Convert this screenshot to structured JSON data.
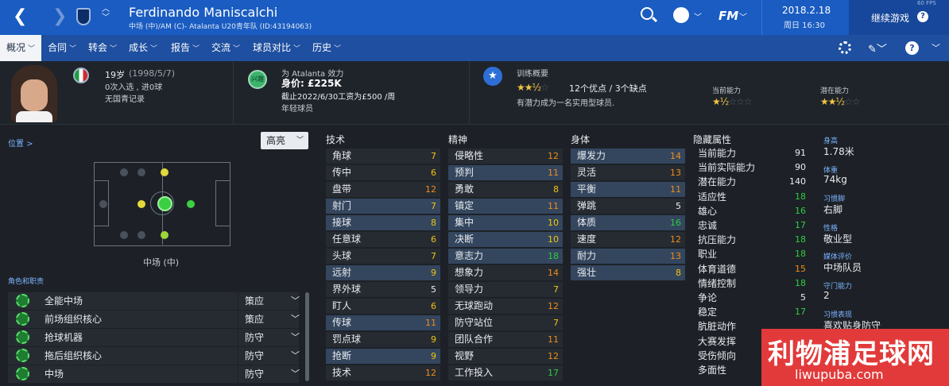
{
  "header": {
    "name": "Ferdinando Maniscalchi",
    "subtitle": "中场 (中)/AM (C)- Atalanta U20青年队 (ID:43194063)",
    "date": "2018.2.18",
    "weekday_time": "周日 16:30",
    "fm_logo": "FM",
    "continue": "继续游戏",
    "fps": "60 FPS"
  },
  "nav": [
    "概况",
    "合同",
    "转会",
    "成长",
    "报告",
    "交流",
    "球员对比",
    "历史"
  ],
  "info": {
    "age": "19岁",
    "dob": "(1998/5/7)",
    "caps": "0次入选 , 进0球",
    "youth": "无国青记录",
    "club_line": "为 Atalanta 效力",
    "interest": "兴趣",
    "value": "身价: £225K",
    "contract": "截止2022/6/30工资为£500 /周",
    "squad": "年轻球员",
    "training_title": "训练概要",
    "training_summary": "12个优点 / 3个缺点",
    "training_desc": "有潜力成为一名实用型球员.",
    "ca_label": "当前能力",
    "pa_label": "潜在能力",
    "training_stars": "★★½",
    "ca_stars": "★½",
    "pa_stars": "★★½"
  },
  "pitch": {
    "pos_link": "位置 >",
    "highlight": "高亮",
    "pos_name": "中场 (中)"
  },
  "roles_header": "角色和职责",
  "roles": [
    {
      "name": "全能中场",
      "duty": "策应"
    },
    {
      "name": "前场组织核心",
      "duty": "策应"
    },
    {
      "name": "抢球机器",
      "duty": "防守"
    },
    {
      "name": "拖后组织核心",
      "duty": "防守"
    },
    {
      "name": "中场",
      "duty": "防守"
    }
  ],
  "tech_title": "技术",
  "tech": [
    {
      "n": "角球",
      "v": "7"
    },
    {
      "n": "传中",
      "v": "6"
    },
    {
      "n": "盘带",
      "v": "12"
    },
    {
      "n": "射门",
      "v": "7"
    },
    {
      "n": "接球",
      "v": "8"
    },
    {
      "n": "任意球",
      "v": "6"
    },
    {
      "n": "头球",
      "v": "7"
    },
    {
      "n": "远射",
      "v": "9"
    },
    {
      "n": "界外球",
      "v": "5"
    },
    {
      "n": "盯人",
      "v": "6"
    },
    {
      "n": "传球",
      "v": "11"
    },
    {
      "n": "罚点球",
      "v": "9"
    },
    {
      "n": "抢断",
      "v": "9"
    },
    {
      "n": "技术",
      "v": "12"
    }
  ],
  "mental_title": "精神",
  "mental": [
    {
      "n": "侵略性",
      "v": "12"
    },
    {
      "n": "预判",
      "v": "11"
    },
    {
      "n": "勇敢",
      "v": "8"
    },
    {
      "n": "镇定",
      "v": "11"
    },
    {
      "n": "集中",
      "v": "10"
    },
    {
      "n": "决断",
      "v": "10"
    },
    {
      "n": "意志力",
      "v": "18"
    },
    {
      "n": "想象力",
      "v": "14"
    },
    {
      "n": "领导力",
      "v": "7"
    },
    {
      "n": "无球跑动",
      "v": "12"
    },
    {
      "n": "防守站位",
      "v": "7"
    },
    {
      "n": "团队合作",
      "v": "11"
    },
    {
      "n": "视野",
      "v": "12"
    },
    {
      "n": "工作投入",
      "v": "17"
    }
  ],
  "physical_title": "身体",
  "physical": [
    {
      "n": "爆发力",
      "v": "14"
    },
    {
      "n": "灵活",
      "v": "13"
    },
    {
      "n": "平衡",
      "v": "11"
    },
    {
      "n": "弹跳",
      "v": "5"
    },
    {
      "n": "体质",
      "v": "16"
    },
    {
      "n": "速度",
      "v": "12"
    },
    {
      "n": "耐力",
      "v": "13"
    },
    {
      "n": "强壮",
      "v": "8"
    }
  ],
  "hidden_title": "隐藏属性",
  "hidden": [
    {
      "n": "当前能力",
      "v": "91"
    },
    {
      "n": "当前实际能力",
      "v": "90"
    },
    {
      "n": "潜在能力",
      "v": "140"
    },
    {
      "n": "适应性",
      "v": "18"
    },
    {
      "n": "雄心",
      "v": "16"
    },
    {
      "n": "忠诚",
      "v": "17"
    },
    {
      "n": "抗压能力",
      "v": "18"
    },
    {
      "n": "职业",
      "v": "18"
    },
    {
      "n": "体育道德",
      "v": "15"
    },
    {
      "n": "情绪控制",
      "v": "18"
    },
    {
      "n": "争论",
      "v": "5"
    },
    {
      "n": "稳定",
      "v": "17"
    },
    {
      "n": "肮脏动作",
      "v": ""
    },
    {
      "n": "大赛发挥",
      "v": ""
    },
    {
      "n": "受伤倾向",
      "v": ""
    },
    {
      "n": "多面性",
      "v": ""
    }
  ],
  "profile": [
    {
      "l": "身高",
      "v": "1.78米"
    },
    {
      "l": "体重",
      "v": "74kg"
    },
    {
      "l": "习惯脚",
      "v": "右脚"
    },
    {
      "l": "性格",
      "v": "敬业型"
    },
    {
      "l": "媒体评价",
      "v": "中场队员"
    },
    {
      "l": "守门能力",
      "v": "2"
    },
    {
      "l": "习惯表现",
      "v": "喜欢贴身防守"
    }
  ],
  "watermark": {
    "cn": "利物浦足球网",
    "url": "liwupuba.com"
  },
  "colors": {
    "topbar": "#1a5cc1",
    "green": "#2ecc40",
    "orange": "#f08c1a",
    "yellow": "#f1c40f",
    "red": "#e74c3c"
  }
}
